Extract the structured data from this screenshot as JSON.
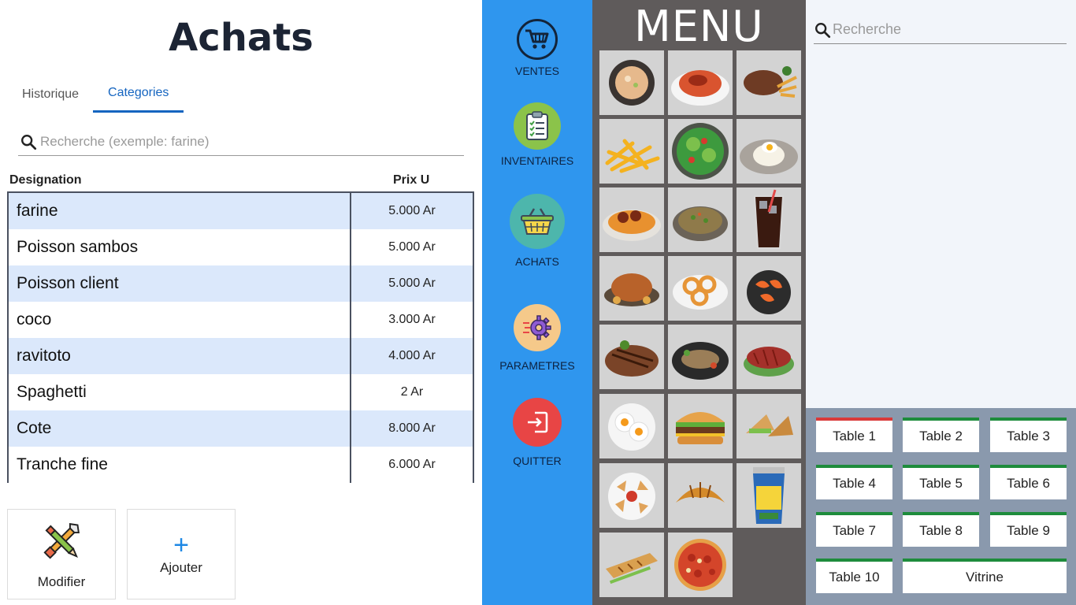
{
  "left": {
    "title": "Achats",
    "tabs": [
      {
        "label": "Historique",
        "active": false
      },
      {
        "label": "Categories",
        "active": true
      }
    ],
    "search_placeholder": "Recherche (exemple: farine)",
    "columns": {
      "designation": "Designation",
      "price": "Prix U"
    },
    "rows": [
      {
        "name": "farine",
        "price": "5.000 Ar"
      },
      {
        "name": "Poisson sambos",
        "price": "5.000 Ar"
      },
      {
        "name": "Poisson client",
        "price": "5.000 Ar"
      },
      {
        "name": "coco",
        "price": "3.000 Ar"
      },
      {
        "name": "ravitoto",
        "price": "4.000 Ar"
      },
      {
        "name": "Spaghetti",
        "price": "2 Ar"
      },
      {
        "name": "Cote",
        "price": "8.000 Ar"
      },
      {
        "name": "Tranche fine",
        "price": "6.000 Ar"
      }
    ],
    "buttons": {
      "modify": "Modifier",
      "add": "Ajouter",
      "add_symbol": "+"
    }
  },
  "nav": [
    {
      "label": "VENTES",
      "icon": "cart-icon",
      "color": "#2b3a55"
    },
    {
      "label": "INVENTAIRES",
      "icon": "clipboard-icon",
      "color": "#8bc34a"
    },
    {
      "label": "ACHATS",
      "icon": "basket-icon",
      "color": "#4db6ac"
    },
    {
      "label": "PARAMETRES",
      "icon": "gear-icon",
      "color": "#f5c98a"
    },
    {
      "label": "QUITTER",
      "icon": "exit-icon",
      "color": "#e84545"
    }
  ],
  "menu": {
    "title": "MENU",
    "items": [
      "soup",
      "spaghetti-bolognese",
      "steak-fries",
      "fries",
      "salad",
      "rice-egg",
      "spaghetti-meatballs",
      "fried-rice",
      "cola",
      "roast-chicken",
      "onion-rings",
      "shrimps",
      "grilled-steak",
      "fish-plate",
      "sliced-beef",
      "fried-eggs",
      "burger",
      "wrap",
      "samosas",
      "croissant",
      "yogurt",
      "panini",
      "pizza"
    ]
  },
  "right": {
    "search_placeholder": "Recherche",
    "tables": [
      {
        "label": "Table 1",
        "status": "busy"
      },
      {
        "label": "Table 2",
        "status": "free"
      },
      {
        "label": "Table 3",
        "status": "free"
      },
      {
        "label": "Table 4",
        "status": "free"
      },
      {
        "label": "Table 5",
        "status": "free"
      },
      {
        "label": "Table 6",
        "status": "free"
      },
      {
        "label": "Table 7",
        "status": "free"
      },
      {
        "label": "Table 8",
        "status": "free"
      },
      {
        "label": "Table 9",
        "status": "free"
      },
      {
        "label": "Table 10",
        "status": "free"
      },
      {
        "label": "Vitrine",
        "status": "free"
      }
    ]
  },
  "colors": {
    "nav_bg": "#2f96ee",
    "menu_bg": "#5f5b5b",
    "accent": "#1565c0",
    "free": "#1e8c3c",
    "busy": "#d93a3a"
  }
}
